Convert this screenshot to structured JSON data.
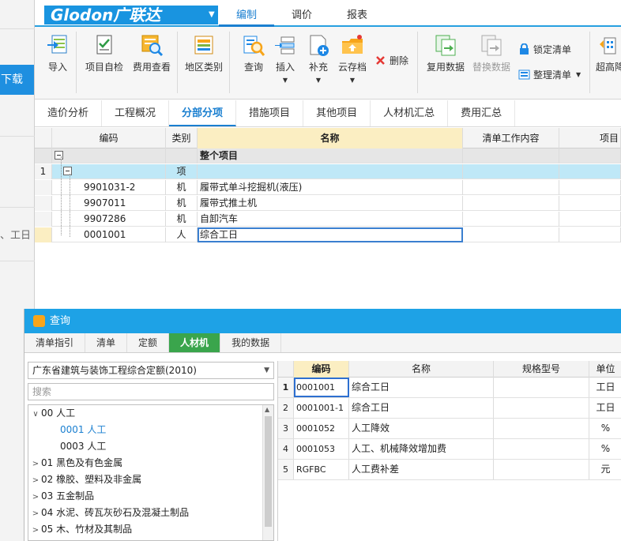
{
  "background": {
    "download_text": "下载",
    "partial_text": "、工日"
  },
  "app": {
    "logo_text": "Glodon广联达",
    "menu_tabs": [
      {
        "label": "编制",
        "active": true
      },
      {
        "label": "调价",
        "active": false
      },
      {
        "label": "报表",
        "active": false
      }
    ],
    "ribbon": {
      "import": "导入",
      "self_check": "项目自检",
      "fee_view": "费用查看",
      "region": "地区类别",
      "query": "查询",
      "insert": "插入",
      "supplement": "补充",
      "cloud_archive": "云存档",
      "delete": "删除",
      "reuse": "复用数据",
      "replace": "替换数据",
      "lock_list": "锁定清单",
      "organize_list": "整理清单",
      "advanced": "超高降"
    },
    "sub_tabs": [
      {
        "label": "造价分析",
        "active": false
      },
      {
        "label": "工程概况",
        "active": false
      },
      {
        "label": "分部分项",
        "active": true
      },
      {
        "label": "措施项目",
        "active": false
      },
      {
        "label": "其他项目",
        "active": false
      },
      {
        "label": "人材机汇总",
        "active": false
      },
      {
        "label": "费用汇总",
        "active": false
      }
    ],
    "grid": {
      "headers": {
        "code": "编码",
        "type": "类别",
        "name": "名称",
        "work": "清单工作内容",
        "item": "项目"
      },
      "whole_project": "整个项目",
      "row1": {
        "num": "1",
        "type": "项"
      },
      "rows": [
        {
          "code": "9901031-2",
          "type": "机",
          "name": "履带式单斗挖掘机(液压)"
        },
        {
          "code": "9907011",
          "type": "机",
          "name": "履带式推土机"
        },
        {
          "code": "9907286",
          "type": "机",
          "name": "自卸汽车"
        },
        {
          "code": "0001001",
          "type": "人",
          "name": "综合工日"
        }
      ]
    }
  },
  "dialog": {
    "title": "查询",
    "tabs": [
      {
        "label": "清单指引",
        "active": false
      },
      {
        "label": "清单",
        "active": false
      },
      {
        "label": "定额",
        "active": false
      },
      {
        "label": "人材机",
        "active": true
      },
      {
        "label": "我的数据",
        "active": false
      }
    ],
    "quota_library": "广东省建筑与装饰工程综合定额(2010)",
    "search_placeholder": "搜索",
    "tree": [
      {
        "label": "00 人工",
        "level": 0,
        "caret": "∨"
      },
      {
        "label": "0001 人工",
        "level": 1,
        "caret": "",
        "selected": true
      },
      {
        "label": "0003 人工",
        "level": 1,
        "caret": ""
      },
      {
        "label": "01 黑色及有色金属",
        "level": 0,
        "caret": ">"
      },
      {
        "label": "02 橡胶、塑料及非金属",
        "level": 0,
        "caret": ">"
      },
      {
        "label": "03 五金制品",
        "level": 0,
        "caret": ">"
      },
      {
        "label": "04 水泥、砖瓦灰砂石及混凝土制品",
        "level": 0,
        "caret": ">"
      },
      {
        "label": "05 木、竹材及其制品",
        "level": 0,
        "caret": ">"
      }
    ],
    "table": {
      "headers": {
        "code": "编码",
        "name": "名称",
        "spec": "规格型号",
        "unit": "单位"
      },
      "rows": [
        {
          "num": "1",
          "code": "0001001",
          "name": "综合工日",
          "spec": "",
          "unit": "工日"
        },
        {
          "num": "2",
          "code": "0001001-1",
          "name": "综合工日",
          "spec": "",
          "unit": "工日"
        },
        {
          "num": "3",
          "code": "0001052",
          "name": "人工降效",
          "spec": "",
          "unit": "%"
        },
        {
          "num": "4",
          "code": "0001053",
          "name": "人工、机械降效增加费",
          "spec": "",
          "unit": "%"
        },
        {
          "num": "5",
          "code": "RGFBC",
          "name": "人工费补差",
          "spec": "",
          "unit": "元"
        }
      ]
    }
  }
}
